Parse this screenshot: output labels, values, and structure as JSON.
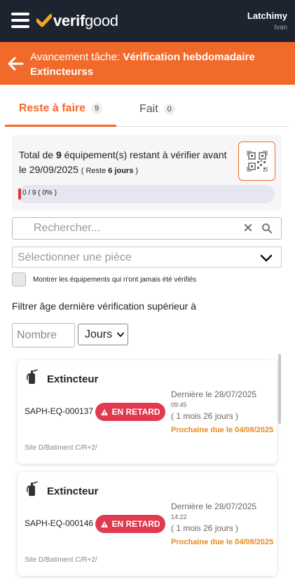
{
  "header": {
    "logo_prefix": "verif",
    "logo_suffix": "good",
    "user_name": "Latchimy",
    "user_sub": "Ivan"
  },
  "task": {
    "label": "Avancement tâche:",
    "name": "Vérification hebdomadaire Extincteurss"
  },
  "tabs": {
    "todo_label": "Reste à faire",
    "todo_count": "9",
    "done_label": "Fait",
    "done_count": "0"
  },
  "summary": {
    "prefix": "Total de ",
    "count": "9",
    "middle": " équipement(s) restant à vérifier avant le 29/09/2025 ",
    "remaining_prefix": "( Reste ",
    "remaining": "6 jours",
    "remaining_suffix": " )",
    "progress_text": "0 / 9 ( 0% )",
    "progress_fraction": 0
  },
  "search": {
    "placeholder": "Rechercher..."
  },
  "room_select": {
    "placeholder": "Sélectionner une pièce"
  },
  "never_checked": {
    "label": "Montrer les équipements qui n'ont jamais été vérifiés"
  },
  "age_filter": {
    "label": "Filtrer âge dernière vérification supérieur à",
    "number_placeholder": "Nombre",
    "unit": "Jours"
  },
  "cards": [
    {
      "title": "Extincteur",
      "code": "SAPH-EQ-000137",
      "badge": "EN RETARD",
      "last": "Dernière le 28/07/2025",
      "time": "09:45",
      "ago": "( 1 mois 26 jours )",
      "next": "Prochaine due le 04/08/2025",
      "site": "Site D/Batiment C/R+2/"
    },
    {
      "title": "Extincteur",
      "code": "SAPH-EQ-000146",
      "badge": "EN RETARD",
      "last": "Dernière le 28/07/2025",
      "time": "14:22",
      "ago": "( 1 mois 26 jours )",
      "next": "Prochaine due le 04/08/2025",
      "site": "Site D/Batiment C/R+2/"
    }
  ],
  "colors": {
    "accent": "#f26a2a",
    "header_bg": "#1d2430",
    "late_badge": "#e03a4f",
    "next_due": "#e68a1f"
  }
}
